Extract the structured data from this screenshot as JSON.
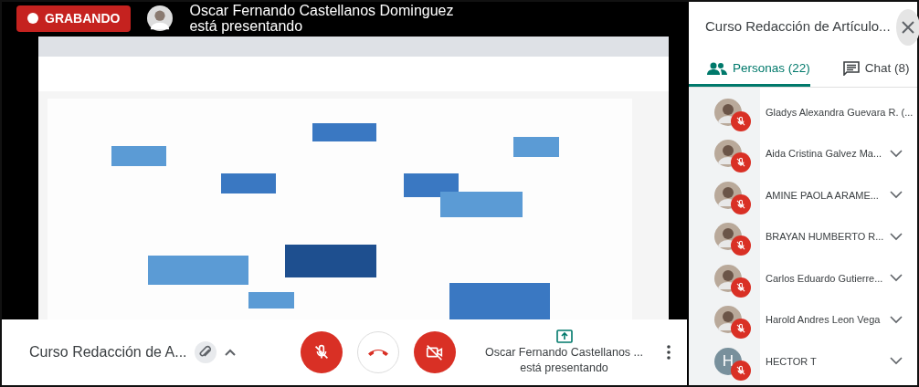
{
  "recording": {
    "label": "GRABANDO",
    "on": true
  },
  "presenter": {
    "name": "Oscar Fernando Castellanos Dominguez",
    "status": "está presentando"
  },
  "meeting_bar": {
    "title": "Curso Redacción de A...",
    "presenter_name": "Oscar Fernando Castellanos ...",
    "presenter_status": "está presentando",
    "controls": [
      {
        "kind": "mic",
        "on": false
      },
      {
        "kind": "hangup"
      },
      {
        "kind": "camera",
        "on": false
      }
    ]
  },
  "panel": {
    "title": "Curso Redacción de Artículo...",
    "tabs": [
      {
        "label": "Personas (22)",
        "kind": "people",
        "selected": true
      },
      {
        "label": "Chat (8)",
        "kind": "chat",
        "selected": false
      }
    ],
    "people": [
      {
        "name": "Gladys Alexandra Guevara R. (...",
        "muted": true,
        "menu": false
      },
      {
        "name": "Aida Cristina Galvez Ma...",
        "muted": true,
        "menu": true
      },
      {
        "name": "AMINE PAOLA ARAME...",
        "muted": true,
        "menu": true
      },
      {
        "name": "BRAYAN HUMBERTO R...",
        "muted": true,
        "menu": true
      },
      {
        "name": "Carlos Eduardo Gutierre...",
        "muted": true,
        "menu": true
      },
      {
        "name": "Harold Andres Leon Vega",
        "muted": true,
        "menu": true
      },
      {
        "name": "HECTOR T",
        "muted": true,
        "menu": true,
        "kind": "letter",
        "initial": "H"
      }
    ]
  }
}
